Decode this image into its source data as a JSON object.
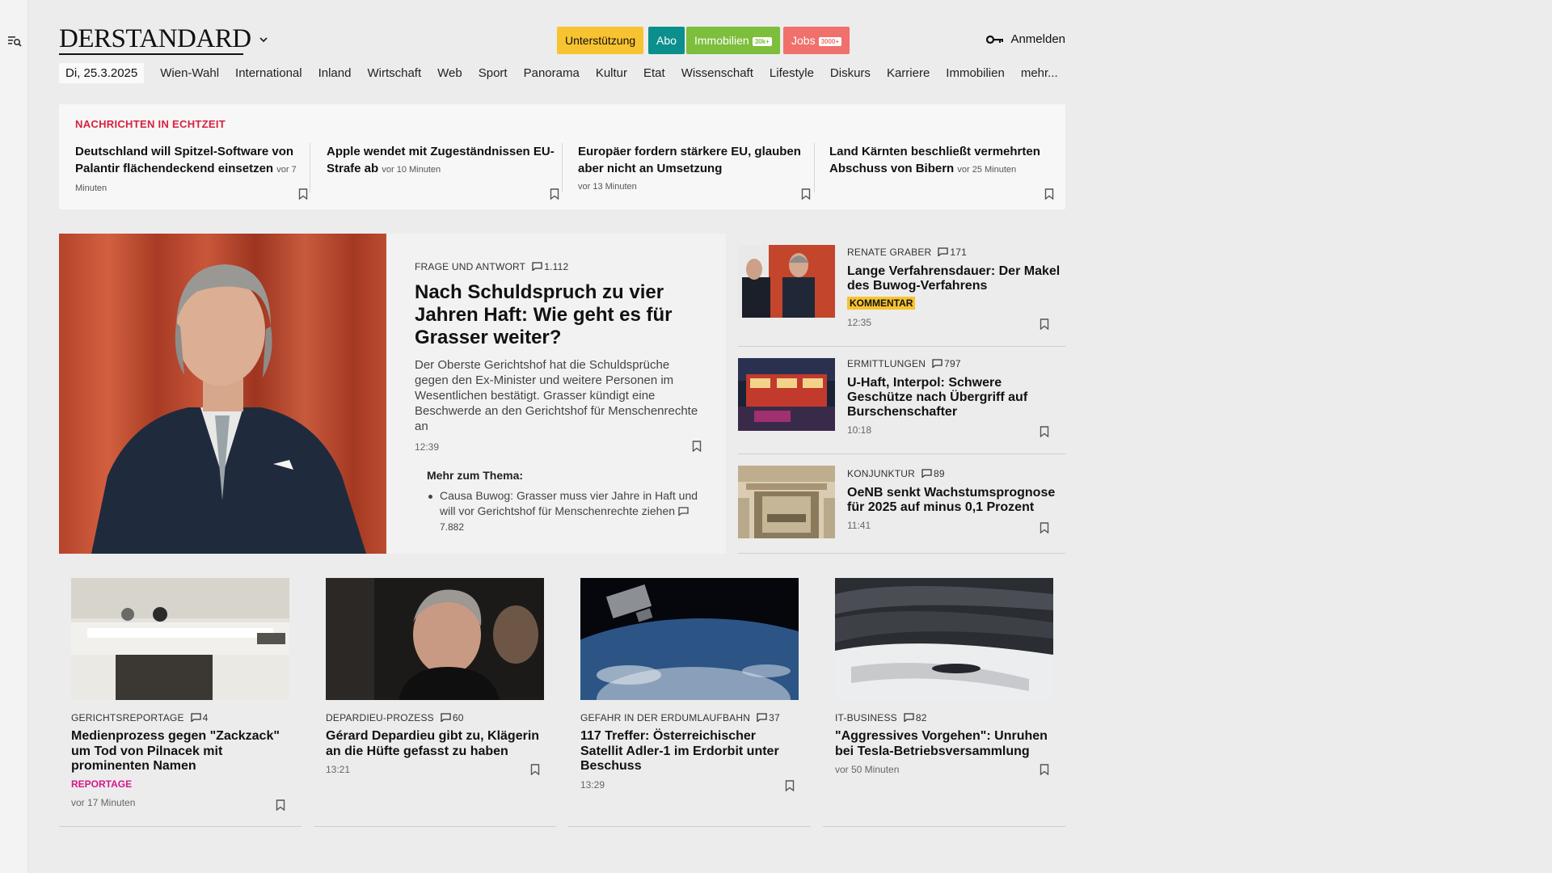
{
  "sidebar": {
    "menu_icon": "menu-search-icon"
  },
  "header": {
    "logo": "DERSTANDARD",
    "pills": [
      {
        "label": "Unterstützung",
        "color": "#f7c331",
        "text_color": "#111"
      },
      {
        "label": "Abo",
        "color": "#0a8f8c",
        "text_color": "#fff"
      },
      {
        "label": "Immobilien",
        "tag": "30k+",
        "color": "#7dbe3c",
        "text_color": "#fff"
      },
      {
        "label": "Jobs",
        "tag": "3000+",
        "color": "#f0706c",
        "text_color": "#fff"
      }
    ],
    "login_label": "Anmelden"
  },
  "nav": {
    "date": "Di, 25.3.2025",
    "items": [
      "Wien-Wahl",
      "International",
      "Inland",
      "Wirtschaft",
      "Web",
      "Sport",
      "Panorama",
      "Kultur",
      "Etat",
      "Wissenschaft",
      "Lifestyle",
      "Diskurs",
      "Karriere",
      "Immobilien",
      "mehr..."
    ]
  },
  "ticker": {
    "label": "NACHRICHTEN IN ECHTZEIT",
    "items": [
      {
        "title": "Deutschland will Spitzel-Software von Palantir flächendeckend einsetzen",
        "ago": "vor 7 Minuten"
      },
      {
        "title": "Apple wendet mit Zugeständnissen EU-Strafe ab",
        "ago": "vor 10 Minuten"
      },
      {
        "title": "Europäer fordern stärkere EU, glauben aber nicht an Umsetzung",
        "ago": "vor 13 Minuten"
      },
      {
        "title": "Land Kärnten beschließt vermehrten Abschuss von Bibern",
        "ago": "vor 25 Minuten"
      }
    ]
  },
  "lead": {
    "kicker": "FRAGE UND ANTWORT",
    "comments": "1.112",
    "title": "Nach Schuldspruch zu vier Jahren Haft: Wie geht es für Grasser weiter?",
    "teaser": "Der Oberste Gerichtshof hat die Schuldsprüche gegen den Ex-Minister und weitere Personen im Wesentlichen bestätigt. Grasser kündigt eine Beschwerde an den Gerichtshof für Menschenrechte an",
    "time": "12:39",
    "more_heading": "Mehr zum Thema:",
    "more_item": "Causa Buwog: Grasser muss vier Jahre in Haft und will vor Gerichtshof für Menschenrechte ziehen",
    "more_comments": "7.882"
  },
  "side_stories": [
    {
      "kicker": "RENATE GRABER",
      "comments": "171",
      "title": "Lange Verfahrensdauer: Der Makel des Buwog-Verfahrens",
      "badge": "KOMMENTAR",
      "badge_color": "#f7c331",
      "time": "12:35"
    },
    {
      "kicker": "ERMITTLUNGEN",
      "comments": "797",
      "title": "U-Haft, Interpol: Schwere Geschütze nach Übergriff auf Burschenschafter",
      "time": "10:18"
    },
    {
      "kicker": "KONJUNKTUR",
      "comments": "89",
      "title": "OeNB senkt Wachstumsprognose für 2025 auf minus 0,1 Prozent",
      "time": "11:41"
    }
  ],
  "cards": [
    {
      "kicker": "GERICHTSREPORTAGE",
      "comments": "4",
      "title": "Medienprozess gegen \"Zackzack\" um Tod von Pilnacek mit prominenten Namen",
      "badge": "REPORTAGE",
      "badge_color": "#d6168c",
      "time": "vor 17 Minuten"
    },
    {
      "kicker": "DEPARDIEU-PROZESS",
      "comments": "60",
      "title": "Gérard Depardieu gibt zu, Klägerin an die Hüfte gefasst zu haben",
      "time": "13:21"
    },
    {
      "kicker": "GEFAHR IN DER ERDUMLAUFBAHN",
      "comments": "37",
      "title": "117 Treffer: Österreichischer Satellit Adler-1 im Erdorbit unter Beschuss",
      "time": "13:29"
    },
    {
      "kicker": "IT-BUSINESS",
      "comments": "82",
      "title": "\"Aggressives Vorgehen\": Unruhen bei Tesla-Betriebsversammlung",
      "time": "vor 50 Minuten"
    }
  ]
}
